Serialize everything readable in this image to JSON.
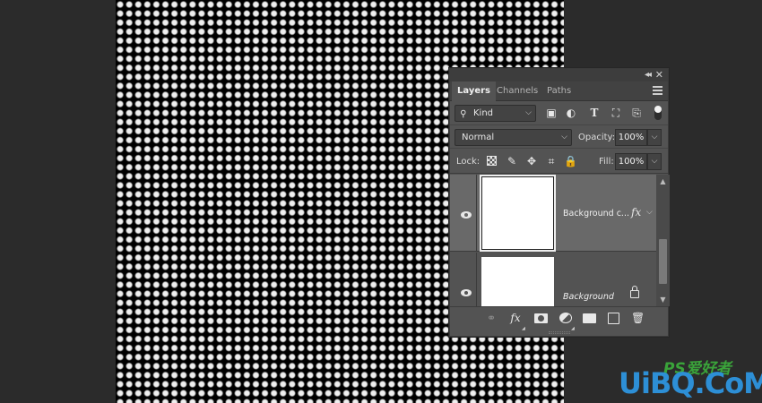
{
  "panel": {
    "tabs": [
      {
        "label": "Layers",
        "active": true
      },
      {
        "label": "Channels",
        "active": false
      },
      {
        "label": "Paths",
        "active": false
      }
    ],
    "filter": {
      "kind_label": "Kind",
      "icons": [
        "pixel-filter-icon",
        "adjustment-filter-icon",
        "type-filter-icon",
        "shape-filter-icon",
        "smart-object-filter-icon"
      ]
    },
    "blend_mode": "Normal",
    "opacity_label": "Opacity:",
    "opacity_value": "100%",
    "lock_label": "Lock:",
    "fill_label": "Fill:",
    "fill_value": "100%",
    "layers": [
      {
        "name": "Background c...",
        "has_fx": true,
        "selected": true,
        "visible": true
      },
      {
        "name": "Background",
        "has_fx": false,
        "locked": true,
        "selected": false,
        "visible": true
      }
    ],
    "glyphs": {
      "collapse": "◂◂",
      "close": "✕",
      "search": "⚲",
      "chevron": "⌵",
      "pixel": "▣",
      "adjust": "◐",
      "type": "T",
      "shape": "⛶",
      "smart": "⎘",
      "brush": "✎",
      "move": "✥",
      "artboard": "⌗",
      "lock": "🔒",
      "fx": "fx",
      "link": "⚭",
      "trash": "🗑",
      "up": "▲",
      "down": "▼",
      "small_tri": "◢"
    }
  },
  "watermark": {
    "top": "PS爱好者",
    "main": "UiBQ.CoM"
  },
  "colors": {
    "panel_bg": "#535353",
    "selected_layer": "#696969",
    "workspace": "#2b2b2b"
  }
}
